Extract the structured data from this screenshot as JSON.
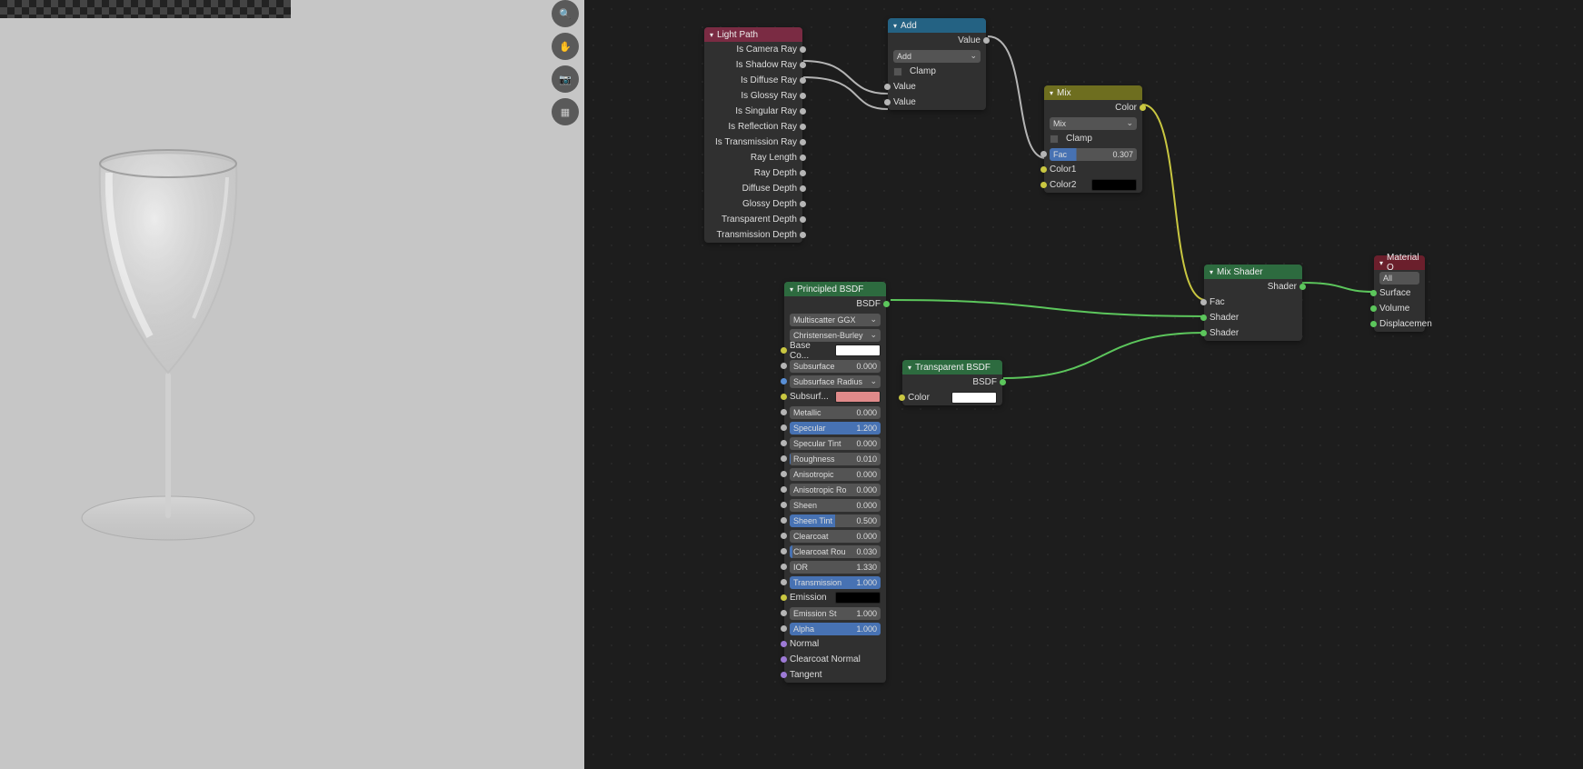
{
  "viewport_tools": [
    "zoom",
    "pan",
    "camera",
    "persp"
  ],
  "lightpath": {
    "title": "Light Path",
    "outs": [
      "Is Camera Ray",
      "Is Shadow Ray",
      "Is Diffuse Ray",
      "Is Glossy Ray",
      "Is Singular Ray",
      "Is Reflection Ray",
      "Is Transmission Ray",
      "Ray Length",
      "Ray Depth",
      "Diffuse Depth",
      "Glossy Depth",
      "Transparent Depth",
      "Transmission Depth"
    ]
  },
  "add": {
    "title": "Add",
    "out": "Value",
    "mode": "Add",
    "clamp": "Clamp",
    "in1": "Value",
    "in2": "Value"
  },
  "mixrgb": {
    "title": "Mix",
    "out": "Color",
    "mode": "Mix",
    "clamp": "Clamp",
    "fac_label": "Fac",
    "fac_val": "0.307",
    "c1": "Color1",
    "c2": "Color2"
  },
  "principled": {
    "title": "Principled BSDF",
    "out": "BSDF",
    "dist": "Multiscatter GGX",
    "sss": "Christensen-Burley",
    "basecolor": "Base Co...",
    "params": [
      {
        "label": "Subsurface",
        "val": "0.000",
        "fill": 0
      },
      {
        "label": "Subsurface Radius",
        "dropdown": true
      },
      {
        "label": "Subsurf...",
        "swatch": "pink"
      },
      {
        "label": "Metallic",
        "val": "0.000",
        "fill": 0
      },
      {
        "label": "Specular",
        "val": "1.200",
        "fill": 100
      },
      {
        "label": "Specular Tint",
        "val": "0.000",
        "fill": 0
      },
      {
        "label": "Roughness",
        "val": "0.010",
        "fill": 1
      },
      {
        "label": "Anisotropic",
        "val": "0.000",
        "fill": 0
      },
      {
        "label": "Anisotropic Ro",
        "val": "0.000",
        "fill": 0
      },
      {
        "label": "Sheen",
        "val": "0.000",
        "fill": 0
      },
      {
        "label": "Sheen Tint",
        "val": "0.500",
        "fill": 50
      },
      {
        "label": "Clearcoat",
        "val": "0.000",
        "fill": 0
      },
      {
        "label": "Clearcoat Rou",
        "val": "0.030",
        "fill": 3
      },
      {
        "label": "IOR",
        "val": "1.330",
        "text": true
      },
      {
        "label": "Transmission",
        "val": "1.000",
        "fill": 100
      },
      {
        "label": "Emission",
        "swatch": "black"
      },
      {
        "label": "Emission St",
        "val": "1.000",
        "text": true
      },
      {
        "label": "Alpha",
        "val": "1.000",
        "fill": 100
      },
      {
        "label": "Normal",
        "plain": true
      },
      {
        "label": "Clearcoat Normal",
        "plain": true
      },
      {
        "label": "Tangent",
        "plain": true
      }
    ]
  },
  "transparent": {
    "title": "Transparent BSDF",
    "out": "BSDF",
    "in": "Color"
  },
  "mixshader": {
    "title": "Mix Shader",
    "out": "Shader",
    "fac": "Fac",
    "s1": "Shader",
    "s2": "Shader"
  },
  "matout": {
    "title": "Material O",
    "target": "All",
    "ins": [
      "Surface",
      "Volume",
      "Displacemen"
    ]
  }
}
